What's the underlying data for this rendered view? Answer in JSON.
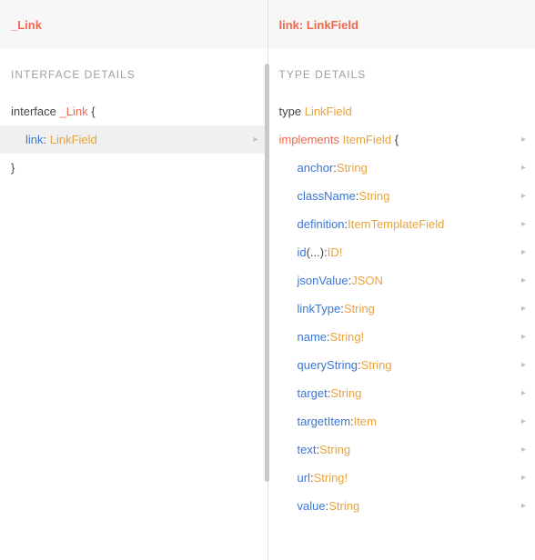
{
  "left": {
    "header_title": "_Link",
    "section_title": "INTERFACE DETAILS",
    "decl_keyword": "interface",
    "decl_name": "_Link",
    "brace_open": "{",
    "brace_close": "}",
    "field": {
      "name": "link",
      "type": "LinkField"
    }
  },
  "right": {
    "header_prefix": "link",
    "header_sep": ": ",
    "header_type": "LinkField",
    "section_title": "TYPE DETAILS",
    "type_keyword": "type",
    "type_name": "LinkField",
    "implements_keyword": "implements",
    "implements_name": "ItemField",
    "brace_open": "{",
    "fields": [
      {
        "name": "anchor",
        "type": "String"
      },
      {
        "name": "className",
        "type": "String"
      },
      {
        "name": "definition",
        "type": "ItemTemplateField"
      },
      {
        "name": "id",
        "args": "(...)",
        "type": "ID!"
      },
      {
        "name": "jsonValue",
        "type": "JSON"
      },
      {
        "name": "linkType",
        "type": "String"
      },
      {
        "name": "name",
        "type": "String!"
      },
      {
        "name": "queryString",
        "type": "String"
      },
      {
        "name": "target",
        "type": "String"
      },
      {
        "name": "targetItem",
        "type": "Item"
      },
      {
        "name": "text",
        "type": "String"
      },
      {
        "name": "url",
        "type": "String!"
      },
      {
        "name": "value",
        "type": "String"
      }
    ]
  },
  "glyphs": {
    "chevron": "▸"
  }
}
